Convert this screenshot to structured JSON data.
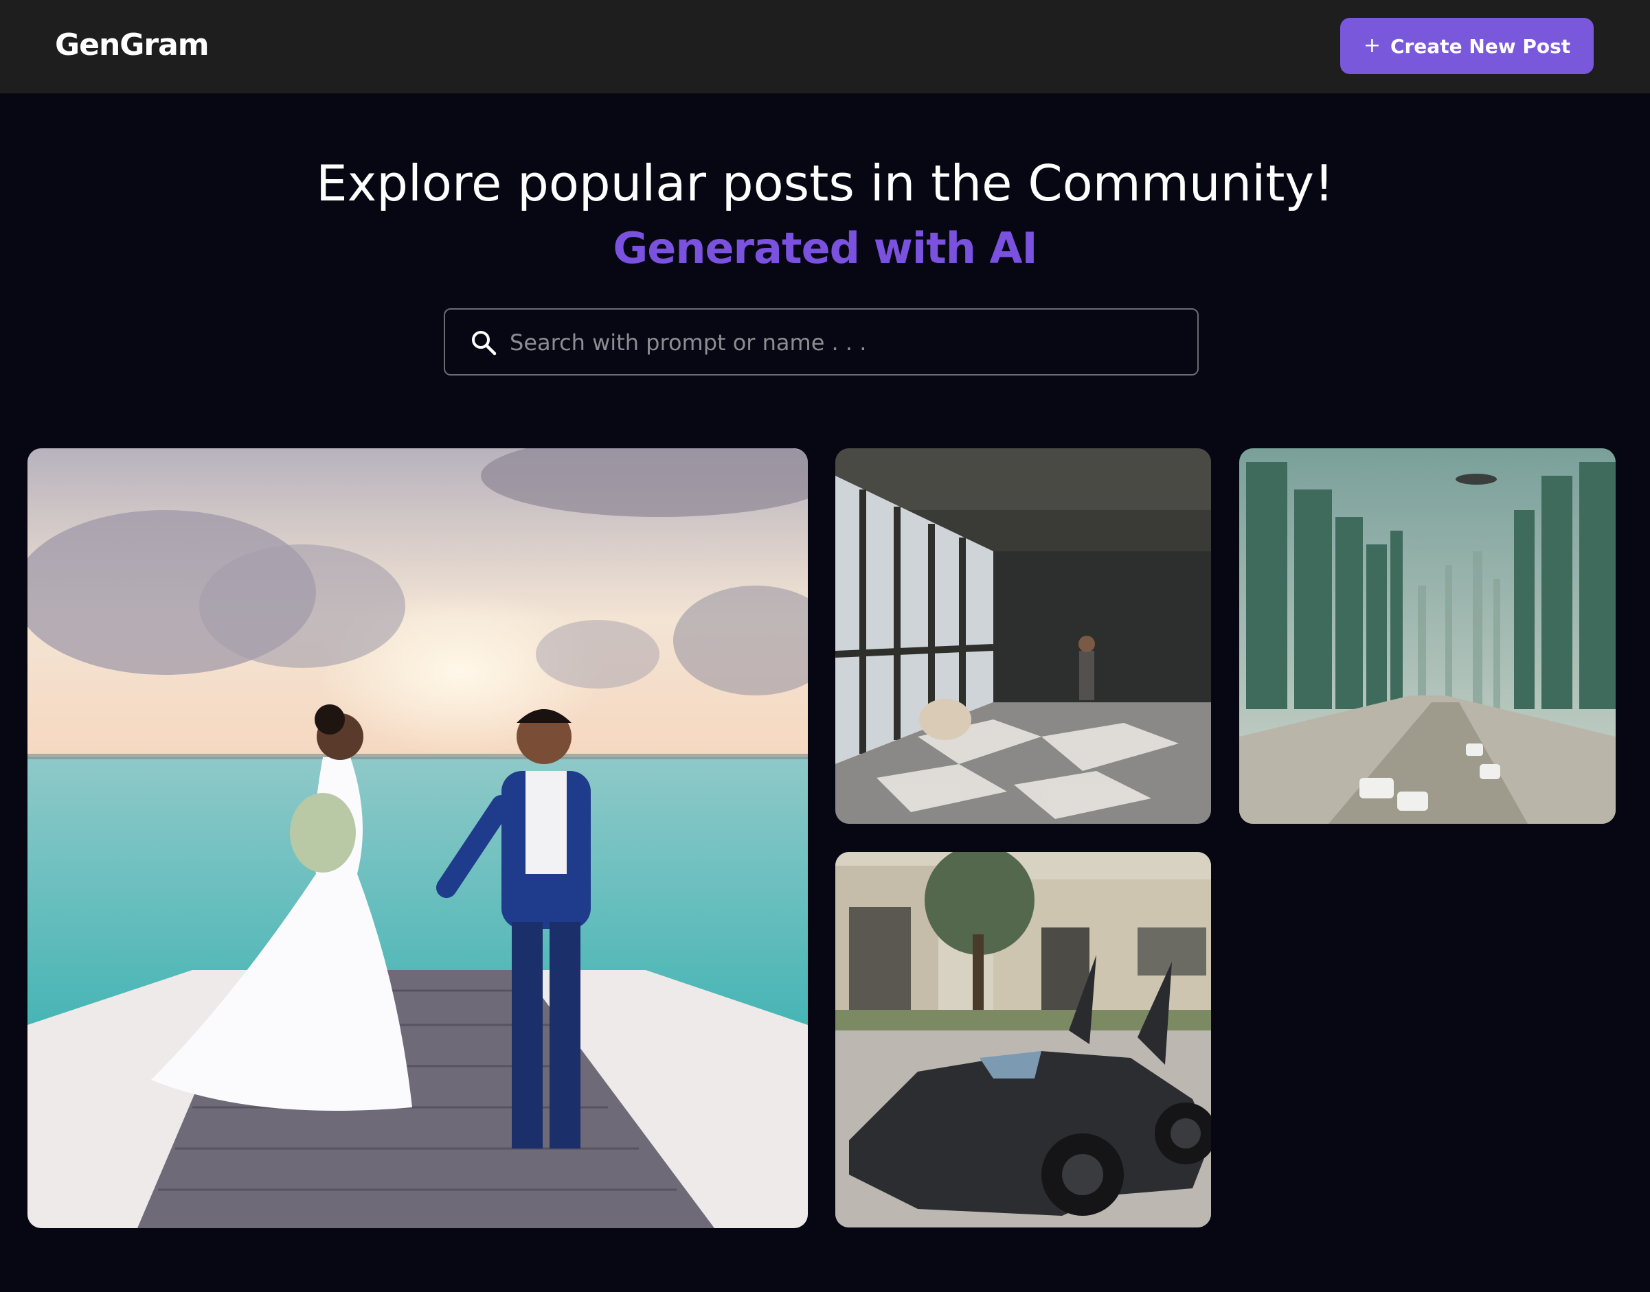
{
  "navbar": {
    "brand": "GenGram",
    "create_button": {
      "icon": "plus-icon",
      "icon_glyph": "+",
      "label": "Create New Post"
    }
  },
  "hero": {
    "title": "Explore popular posts in the Community!",
    "subtitle": "Generated with AI"
  },
  "search": {
    "icon": "search-icon",
    "placeholder": "Search with prompt or name . . .",
    "value": ""
  },
  "posts": [
    {
      "subject": "wedding couple on a pier at sunset"
    },
    {
      "subject": "man standing in an empty sunlit room"
    },
    {
      "subject": "futuristic city street"
    },
    {
      "subject": "black batmobile-style car"
    }
  ],
  "colors": {
    "background": "#070713",
    "navbar": "#1e1e1f",
    "accent": "#7a58dc",
    "subtitle": "#7b52e0"
  }
}
